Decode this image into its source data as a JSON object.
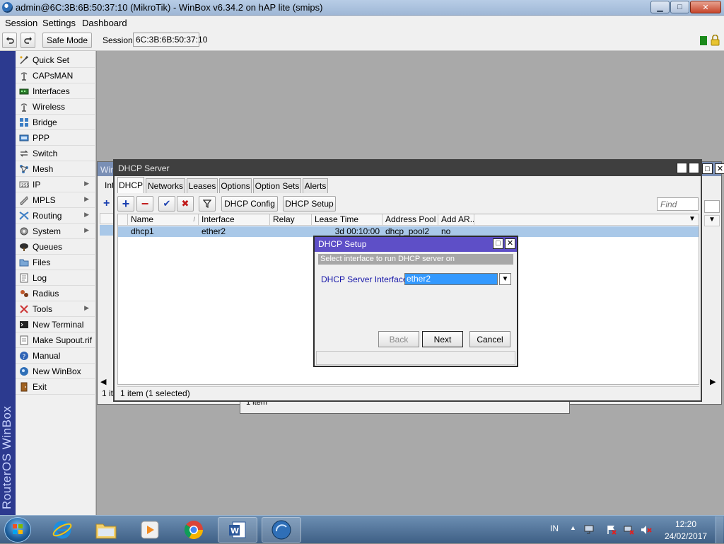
{
  "window": {
    "title": "admin@6C:3B:6B:50:37:10 (MikroTik) - WinBox v6.34.2 on hAP lite (smips)",
    "minimize_glyph": "▁",
    "maximize_glyph": "□",
    "close_glyph": "✕"
  },
  "menu": [
    "Session",
    "Settings",
    "Dashboard"
  ],
  "toolbar": {
    "undo_icon": "undo-icon",
    "redo_icon": "redo-icon",
    "safe_mode_label": "Safe Mode",
    "session_label": "Session:",
    "session_value": "6C:3B:6B:50:37:10"
  },
  "sidebar": {
    "brand": "RouterOS WinBox",
    "items": [
      {
        "label": "Quick Set",
        "icon": "quick-set-icon",
        "submenu": false
      },
      {
        "label": "CAPsMAN",
        "icon": "capsman-icon",
        "submenu": false
      },
      {
        "label": "Interfaces",
        "icon": "interfaces-icon",
        "submenu": false
      },
      {
        "label": "Wireless",
        "icon": "wireless-icon",
        "submenu": false
      },
      {
        "label": "Bridge",
        "icon": "bridge-icon",
        "submenu": false
      },
      {
        "label": "PPP",
        "icon": "ppp-icon",
        "submenu": false
      },
      {
        "label": "Switch",
        "icon": "switch-icon",
        "submenu": false
      },
      {
        "label": "Mesh",
        "icon": "mesh-icon",
        "submenu": false
      },
      {
        "label": "IP",
        "icon": "ip-icon",
        "submenu": true
      },
      {
        "label": "MPLS",
        "icon": "mpls-icon",
        "submenu": true
      },
      {
        "label": "Routing",
        "icon": "routing-icon",
        "submenu": true
      },
      {
        "label": "System",
        "icon": "system-icon",
        "submenu": true
      },
      {
        "label": "Queues",
        "icon": "queues-icon",
        "submenu": false
      },
      {
        "label": "Files",
        "icon": "files-icon",
        "submenu": false
      },
      {
        "label": "Log",
        "icon": "log-icon",
        "submenu": false
      },
      {
        "label": "Radius",
        "icon": "radius-icon",
        "submenu": false
      },
      {
        "label": "Tools",
        "icon": "tools-icon",
        "submenu": true
      },
      {
        "label": "New Terminal",
        "icon": "terminal-icon",
        "submenu": false
      },
      {
        "label": "Make Supout.rif",
        "icon": "supout-icon",
        "submenu": false
      },
      {
        "label": "Manual",
        "icon": "manual-icon",
        "submenu": false
      },
      {
        "label": "New WinBox",
        "icon": "winbox-icon",
        "submenu": false
      },
      {
        "label": "Exit",
        "icon": "exit-icon",
        "submenu": false
      }
    ]
  },
  "back_window": {
    "title_fragment": "Wire",
    "tab_fragment": "Inte",
    "status_fragment": "1 ite",
    "lower_status": "1 item"
  },
  "dhcp_server": {
    "title": "DHCP Server",
    "tabs": [
      "DHCP",
      "Networks",
      "Leases",
      "Options",
      "Option Sets",
      "Alerts"
    ],
    "active_tab": "DHCP",
    "buttons": {
      "add": "+",
      "remove": "−",
      "enable": "✔",
      "disable": "✖",
      "filter": "filter-icon",
      "config": "DHCP Config",
      "setup": "DHCP Setup"
    },
    "find_placeholder": "Find",
    "columns": [
      "Name",
      "Interface",
      "Relay",
      "Lease Time",
      "Address Pool",
      "Add AR..."
    ],
    "rows": [
      {
        "name": "dhcp1",
        "interface": "ether2",
        "relay": "",
        "lease_time": "3d 00:10:00",
        "address_pool": "dhcp_pool2",
        "add_arp": "no"
      }
    ],
    "status": "1 item (1 selected)"
  },
  "dhcp_setup": {
    "title": "DHCP Setup",
    "instruction": "Select interface to run DHCP server on",
    "field_label": "DHCP Server Interface:",
    "field_value": "ether2",
    "back_label": "Back",
    "next_label": "Next",
    "cancel_label": "Cancel"
  },
  "taskbar": {
    "apps": [
      "start",
      "internet-explorer",
      "file-explorer",
      "media-player",
      "chrome",
      "word",
      "winbox"
    ],
    "lang": "IN",
    "time": "12:20",
    "date": "24/02/2017"
  },
  "colors": {
    "sidebar_strip": "#2c3a8f",
    "dialog_title": "#5e4fc7",
    "selected_row": "#a9c8e8",
    "selected_field": "#3399ff"
  }
}
